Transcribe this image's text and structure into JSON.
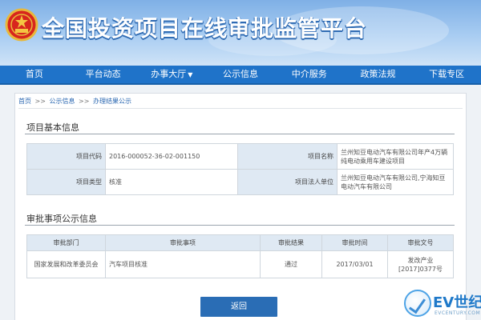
{
  "header": {
    "site_title": "全国投资项目在线审批监管平台"
  },
  "nav": {
    "items": [
      {
        "label": "首页"
      },
      {
        "label": "平台动态"
      },
      {
        "label": "办事大厅",
        "has_dropdown": true,
        "caret": "▼"
      },
      {
        "label": "公示信息"
      },
      {
        "label": "中介服务"
      },
      {
        "label": "政策法规"
      },
      {
        "label": "下载专区"
      }
    ]
  },
  "breadcrumb": {
    "items": [
      "首页",
      "公示信息",
      "办理结果公示"
    ],
    "separator": ">>"
  },
  "basic_info": {
    "title": "项目基本信息",
    "rows": [
      {
        "k1": "项目代码",
        "v1": "2016-000052-36-02-001150",
        "k2": "项目名称",
        "v2": "兰州知豆电动汽车有限公司年产4万辆纯电动乘用车建设项目"
      },
      {
        "k1": "项目类型",
        "v1": "核准",
        "k2": "项目法人单位",
        "v2": "兰州知豆电动汽车有限公司,宁海知豆电动汽车有限公司"
      }
    ]
  },
  "approval": {
    "title": "审批事项公示信息",
    "headers": [
      "审批部门",
      "审批事项",
      "审批结果",
      "审批时间",
      "审批文号"
    ],
    "rows": [
      {
        "dept": "国家发展和改革委员会",
        "item": "汽车项目核准",
        "result": "通过",
        "date": "2017/03/01",
        "doc_no": "发改产业[2017]0377号"
      }
    ]
  },
  "actions": {
    "return_label": "返回"
  },
  "watermark": {
    "brand": "EV世纪",
    "sub": "EVCENTURY.COM"
  },
  "colors": {
    "nav_bg": "#1f73c9",
    "table_header_bg": "#dfe9f3",
    "button_bg": "#2a6db5",
    "link": "#2a67b1"
  },
  "icons": {
    "emblem": "national-emblem-icon",
    "watermark": "ev-century-logo"
  }
}
